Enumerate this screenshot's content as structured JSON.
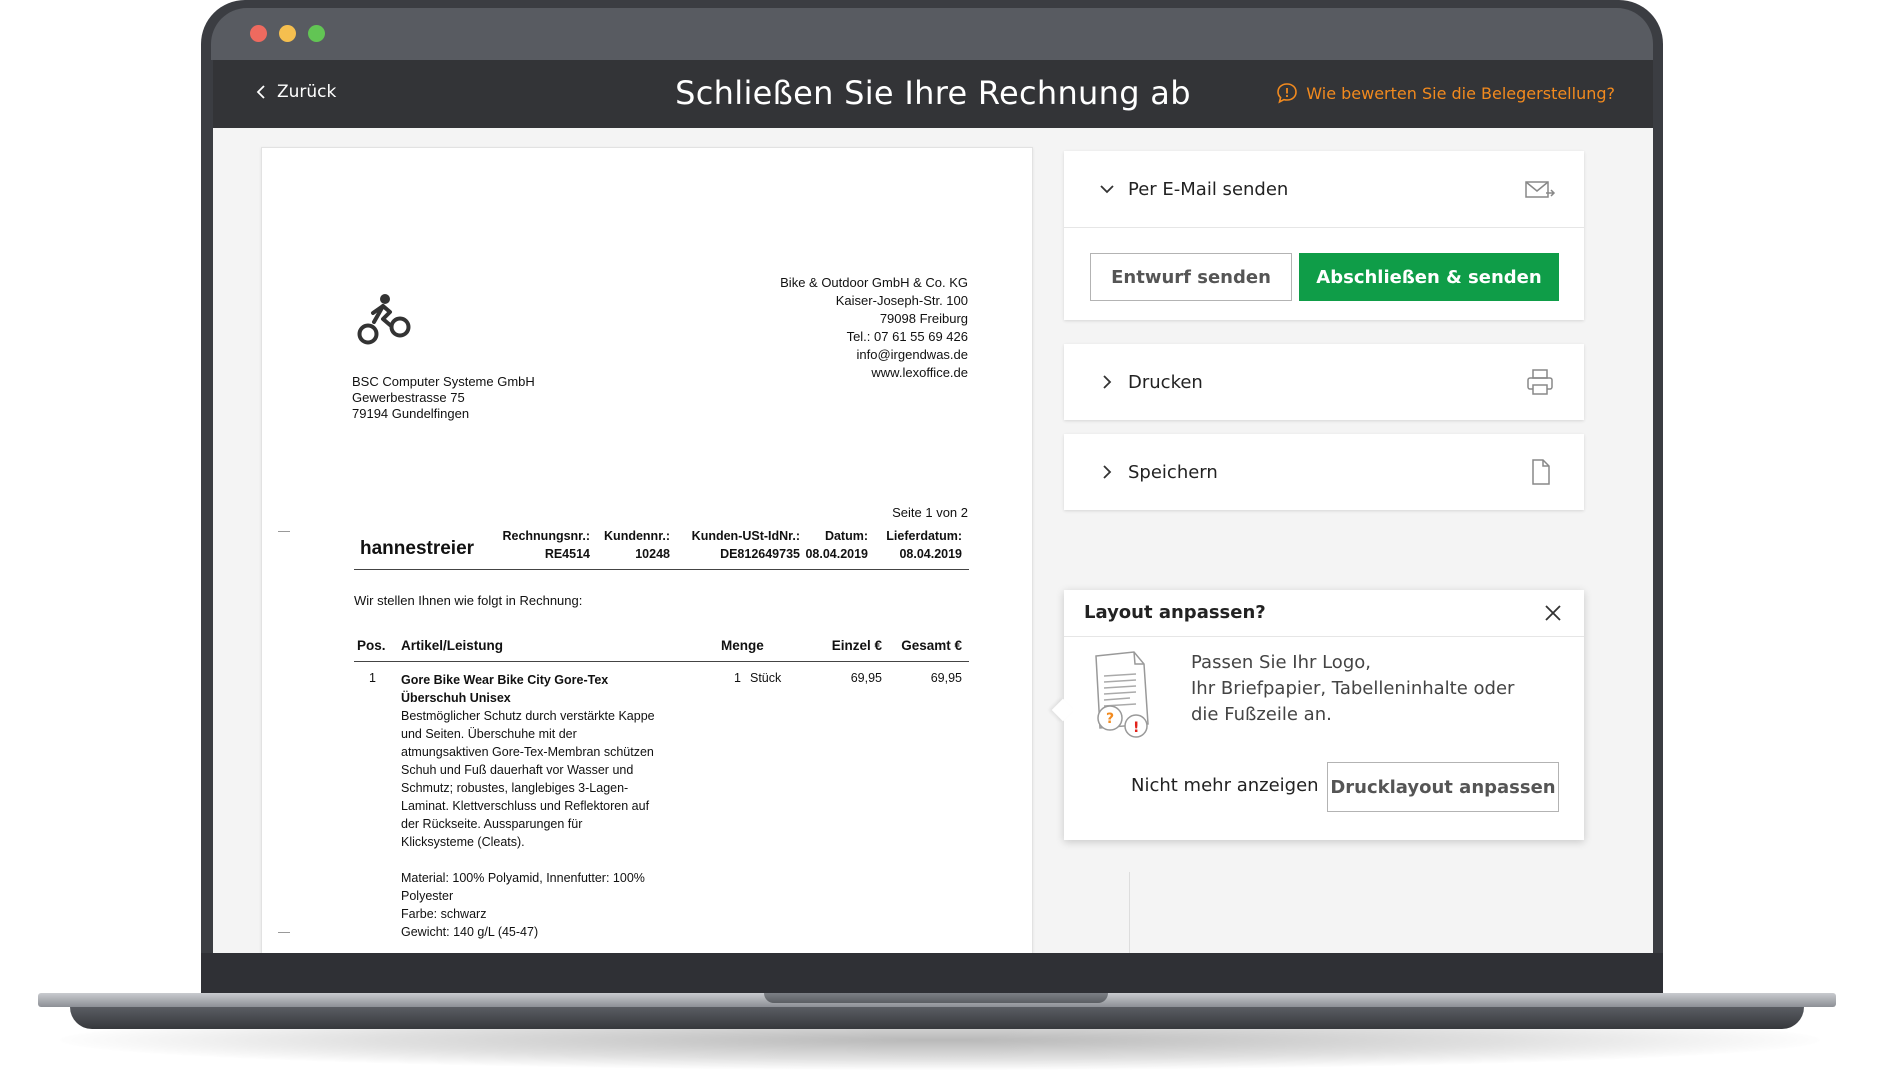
{
  "topbar": {
    "back_label": "Zurück",
    "title": "Schließen Sie Ihre Rechnung ab",
    "feedback_label": "Wie bewerten Sie die Belegerstellung?"
  },
  "invoice": {
    "sender_lines": [
      "Bike & Outdoor GmbH & Co. KG",
      "Kaiser-Joseph-Str. 100",
      "79098 Freiburg",
      "Tel.: 07 61 55 69 426",
      "info@irgendwas.de",
      "www.lexoffice.de"
    ],
    "recipient_lines": [
      "BSC Computer Systeme GmbH",
      "Gewerbestrasse 75",
      "79194 Gundelfingen"
    ],
    "page_indicator": "Seite 1 von 2",
    "name": "hannestreier",
    "meta": [
      {
        "label": "Rechnungsnr.:",
        "value": "RE4514"
      },
      {
        "label": "Kundennr.:",
        "value": "10248"
      },
      {
        "label": "Kunden-USt-IdNr.:",
        "value": "DE812649735"
      },
      {
        "label": "Datum:",
        "value": "08.04.2019"
      },
      {
        "label": "Lieferdatum:",
        "value": "08.04.2019"
      }
    ],
    "intro": "Wir stellen Ihnen wie folgt in Rechnung:",
    "columns": {
      "pos": "Pos.",
      "article": "Artikel/Leistung",
      "qty": "Menge",
      "unit_price": "Einzel €",
      "total": "Gesamt €"
    },
    "item": {
      "pos": "1",
      "title_line1": "Gore Bike Wear Bike City Gore-Tex",
      "title_line2": "Überschuh Unisex",
      "description": [
        "Bestmöglicher Schutz durch verstärkte Kappe",
        "und Seiten. Überschuhe mit der",
        "atmungsaktiven Gore-Tex-Membran schützen",
        "Schuh und Fuß dauerhaft vor Wasser und",
        "Schmutz; robustes, langlebiges 3-Lagen-",
        "Laminat. Klettverschluss und Reflektoren auf",
        "der Rückseite. Aussparungen für",
        "Klicksysteme (Cleats)."
      ],
      "details": [
        "Material: 100% Polyamid, Innenfutter: 100%",
        "Polyester",
        "Farbe: schwarz",
        "Gewicht: 140 g/L (45-47)"
      ],
      "qty": "1",
      "unit": "Stück",
      "unit_price": "69,95",
      "total": "69,95"
    }
  },
  "actions": {
    "email_label": "Per E-Mail senden",
    "draft_button": "Entwurf senden",
    "finalize_button": "Abschließen & senden",
    "print_label": "Drucken",
    "save_label": "Speichern"
  },
  "popup": {
    "title": "Layout anpassen?",
    "text_lines": [
      "Passen Sie Ihr Logo,",
      "Ihr Briefpapier, Tabelleninhalte oder",
      "die Fußzeile an."
    ],
    "dismiss_label": "Nicht mehr anzeigen",
    "button_label": "Drucklayout anpassen"
  },
  "colors": {
    "accent_orange": "#f28a1e",
    "primary_green": "#0f9d48",
    "topbar_bg": "#333437"
  }
}
